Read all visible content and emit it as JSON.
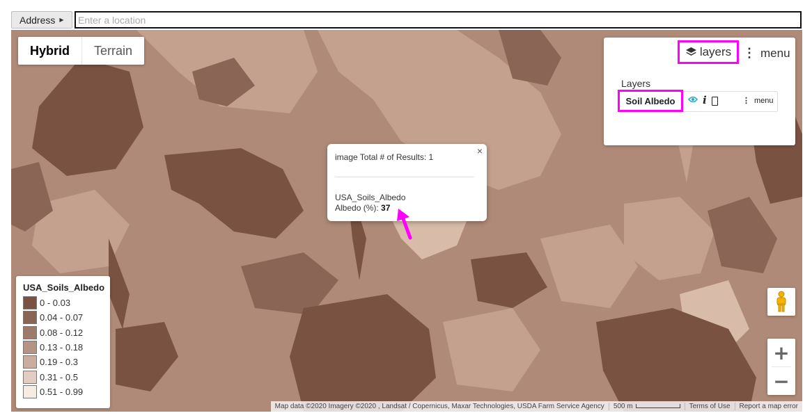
{
  "address": {
    "button_label": "Address",
    "placeholder": "Enter a location"
  },
  "map_type": {
    "options": [
      "Hybrid",
      "Terrain"
    ],
    "selected": "Hybrid"
  },
  "layers_panel": {
    "layers_button_label": "layers",
    "menu_button_label": "menu",
    "title": "Layers",
    "layer": {
      "name": "Soil Albedo",
      "info_glyph": "i",
      "menu_label": "menu",
      "icons": [
        "eye-icon",
        "info-icon",
        "phone-icon",
        "more-vert-icon"
      ]
    },
    "highlight_color": "#ff00ff"
  },
  "info_window": {
    "header": "image Total # of Results: 1",
    "layer_name": "USA_Soils_Albedo",
    "field_label": "Albedo (%): ",
    "field_value": "37",
    "close_glyph": "×"
  },
  "annotation": {
    "arrow_color": "#ff00ff"
  },
  "legend": {
    "title": "USA_Soils_Albedo",
    "items": [
      {
        "label": "0 - 0.03",
        "color": "#7a5242"
      },
      {
        "label": "0.04 - 0.07",
        "color": "#8a6455"
      },
      {
        "label": "0.08 - 0.12",
        "color": "#9c7b6d"
      },
      {
        "label": "0.13 - 0.18",
        "color": "#b39485"
      },
      {
        "label": "0.19 - 0.3",
        "color": "#c9ad9f"
      },
      {
        "label": "0.31 - 0.5",
        "color": "#e1cdc1"
      },
      {
        "label": "0.51 - 0.99",
        "color": "#f6ece2"
      }
    ]
  },
  "map_colors": {
    "base": "#b08a78",
    "dark": "#7a5242",
    "light": "#c4a08e",
    "lighter": "#d8bca9"
  },
  "footer": {
    "attribution": "Map data ©2020 Imagery ©2020 , Landsat / Copernicus, Maxar Technologies, USDA Farm Service Agency",
    "scale": "500 m",
    "terms": "Terms of Use",
    "report": "Report a map error"
  },
  "controls": {
    "zoom_in": "+",
    "zoom_out": "−"
  }
}
